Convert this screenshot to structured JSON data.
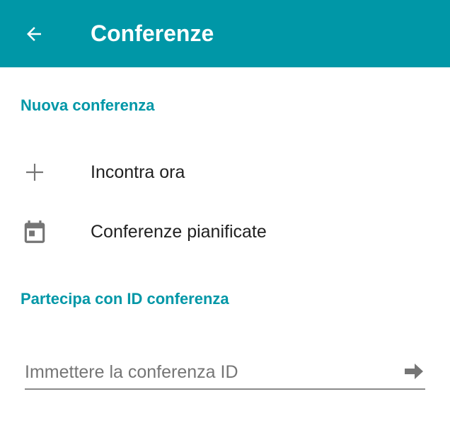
{
  "app_bar": {
    "title": "Conferenze",
    "back_icon": "arrow-left-icon",
    "background_color": "#0097a7"
  },
  "sections": {
    "new_conference": {
      "header": "Nuova conferenza",
      "items": [
        {
          "label": "Incontra ora",
          "icon": "plus-icon"
        },
        {
          "label": "Conferenze pianificate",
          "icon": "calendar-icon"
        }
      ]
    },
    "join_by_id": {
      "header": "Partecipa con ID conferenza",
      "input_value": "",
      "input_placeholder": "Immettere la conferenza ID",
      "submit_icon": "arrow-right-icon"
    }
  },
  "colors": {
    "accent": "#0097a7",
    "icon_gray": "#757575",
    "text_primary": "#212121"
  }
}
